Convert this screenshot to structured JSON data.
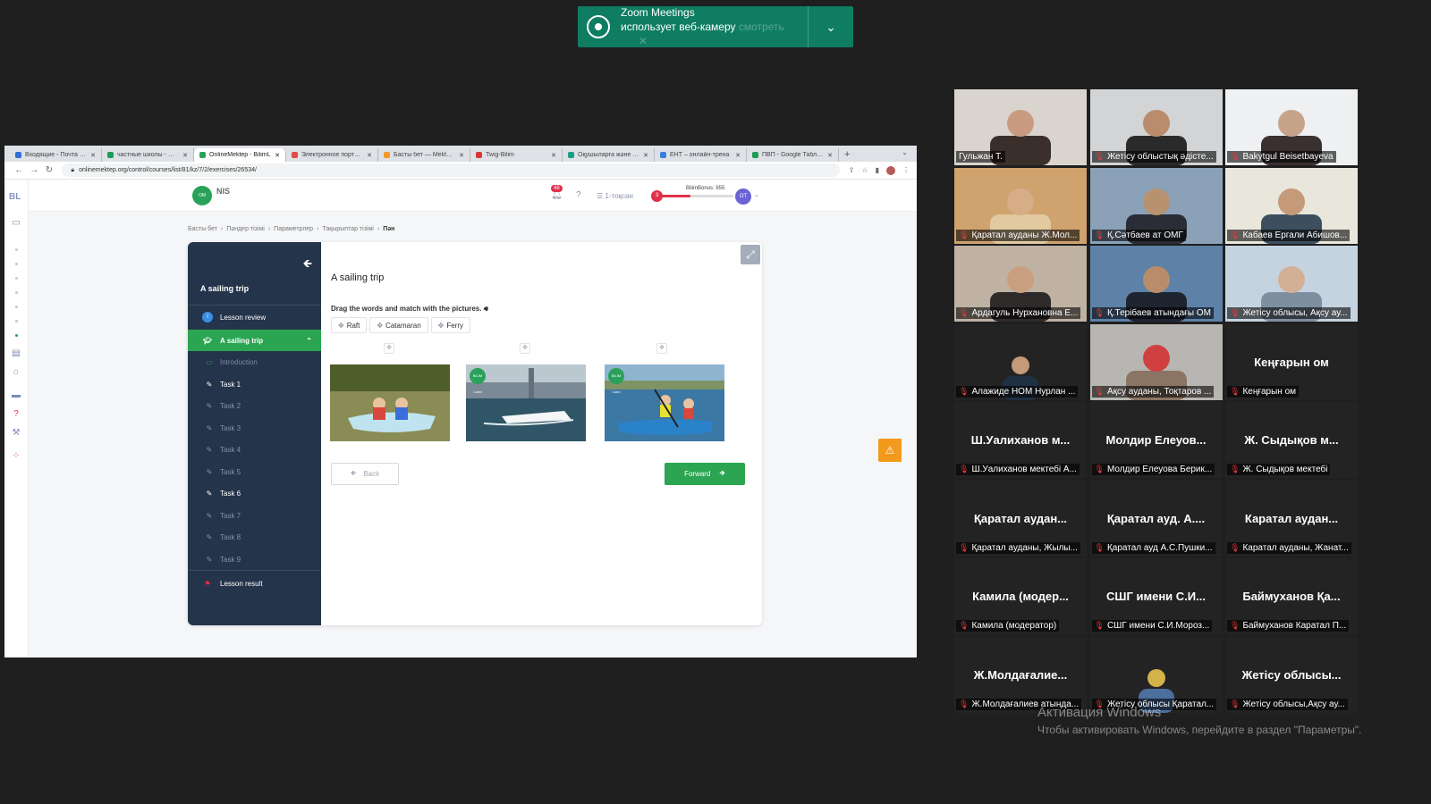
{
  "notification": {
    "app": "Zoom Meetings",
    "message": "использует веб-камеру",
    "faded_text": "смотреть"
  },
  "browser": {
    "tabs": [
      {
        "label": "Входящие - Почта Mail",
        "color": "#2f6fd8"
      },
      {
        "label": "частные школы - Google",
        "color": "#1e9d54"
      },
      {
        "label": "OnlineMektep - BilimL",
        "color": "#2aa15a",
        "active": true
      },
      {
        "label": "Электронное портфолио",
        "color": "#e24a4a"
      },
      {
        "label": "Басты бет — Mektep.k",
        "color": "#f09a2a"
      },
      {
        "label": "Twig-Bilim",
        "color": "#d93636"
      },
      {
        "label": "Оқушыларға және студ",
        "color": "#1aa089"
      },
      {
        "label": "ЕНТ – онлайн-трена",
        "color": "#3b7de0"
      },
      {
        "label": "ПВП - Google Таблицы",
        "color": "#1e9d54"
      }
    ],
    "url": "onlinemektep.org/control/courses/list/81/kz/7/2/exercises/26534/"
  },
  "site": {
    "brand_short": "BL",
    "logo_text": "NIS",
    "notifications_count": "48",
    "quarter": "1-тоқсан",
    "bonus_label": "BilimBonus: 655",
    "bonus_level": "3",
    "bonus_progress": 0.45,
    "avatar_initials": "ОТ",
    "breadcrumb": [
      "Басты бет",
      "Пәндер тізімі",
      "Параметрлер",
      "Тақырыптар тізімі",
      "Пән"
    ]
  },
  "lesson": {
    "sidebar_title": "A sailing trip",
    "review": "Lesson review",
    "section": "A sailing trip",
    "intro": "Introduction",
    "tasks": [
      {
        "label": "Task 1",
        "done": true
      },
      {
        "label": "Task 2",
        "done": false
      },
      {
        "label": "Task 3",
        "done": false
      },
      {
        "label": "Task 4",
        "done": false
      },
      {
        "label": "Task 5",
        "done": false
      },
      {
        "label": "Task 6",
        "done": true
      },
      {
        "label": "Task 7",
        "done": false
      },
      {
        "label": "Task 8",
        "done": false
      },
      {
        "label": "Task 9",
        "done": false
      }
    ],
    "result": "Lesson result",
    "title": "A sailing trip",
    "instruction": "Drag the words and match with the pictures.",
    "words": [
      "Raft",
      "Catamaran",
      "Ferry"
    ],
    "image_badge": "BILIM Land",
    "back": "Back",
    "forward": "Forward"
  },
  "participants": [
    {
      "name": "Гульжан Т.",
      "video": "woman-glasses",
      "muted": false,
      "speaking": true
    },
    {
      "name": "Жетісу облыстық әдісте...",
      "video": "woman-headset",
      "muted": true
    },
    {
      "name": "Bakytgul Beisetbayeva",
      "video": "person-window",
      "muted": true
    },
    {
      "name": "Қаратал ауданы Ж.Мол...",
      "video": "woman-blonde",
      "muted": true
    },
    {
      "name": "Қ.Сәтбаев ат ОМГ",
      "video": "man-desk",
      "muted": true
    },
    {
      "name": "Кабаев Ергали Абишов...",
      "video": "man-portrait",
      "muted": true
    },
    {
      "name": "Ардагуль Нурхановна Е...",
      "video": "woman-glasses2",
      "muted": true
    },
    {
      "name": "Қ.Терібаев атындағы ОМ",
      "video": "man-flag",
      "muted": true
    },
    {
      "name": "Жетісу облысы, Ақсу ау...",
      "video": "classroom",
      "muted": true
    },
    {
      "name": "Алажиде НОМ Нурлан ...",
      "video": "man-small",
      "muted": true
    },
    {
      "name": "Ақсу ауданы, Тоқтаров ...",
      "video": "room",
      "muted": true
    },
    {
      "name": "Кеңғарын ом",
      "display": "Кеңғарын ом",
      "muted": true
    },
    {
      "name": "Ш.Уалиханов мектебі А...",
      "display": "Ш.Уалиханов м...",
      "muted": true
    },
    {
      "name": "Молдир Елеуова Берик...",
      "display": "Молдир Елеуов...",
      "muted": true
    },
    {
      "name": "Ж. Сыдықов мектебі",
      "display": "Ж. Сыдықов м...",
      "muted": true
    },
    {
      "name": "Қаратал ауданы, Жылы...",
      "display": "Қаратал аудан...",
      "muted": true
    },
    {
      "name": "Қаратал ауд А.С.Пушки...",
      "display": "Қаратал ауд. А....",
      "muted": true
    },
    {
      "name": "Каратал ауданы, Жанат...",
      "display": "Каратал аудан...",
      "muted": true
    },
    {
      "name": "Камила (модератор)",
      "display": "Камила (модер...",
      "muted": true
    },
    {
      "name": "СШГ имени С.И.Мороз...",
      "display": "СШГ имени С.И...",
      "muted": true
    },
    {
      "name": "Баймуханов Каратал П...",
      "display": "Баймуханов Қа...",
      "muted": true
    },
    {
      "name": "Ж.Молдағалиев атында...",
      "display": "Ж.Молдағалие...",
      "muted": true
    },
    {
      "name": "Жетісу облысы Қаратал...",
      "video": "emblem-person",
      "muted": true
    },
    {
      "name": "Жетісу облысы,Ақсу ау...",
      "display": "Жетісу облысы...",
      "muted": true
    }
  ],
  "windows_activation": {
    "title": "Активация Windows",
    "subtitle": "Чтобы активировать Windows, перейдите в раздел \"Параметры\"."
  }
}
